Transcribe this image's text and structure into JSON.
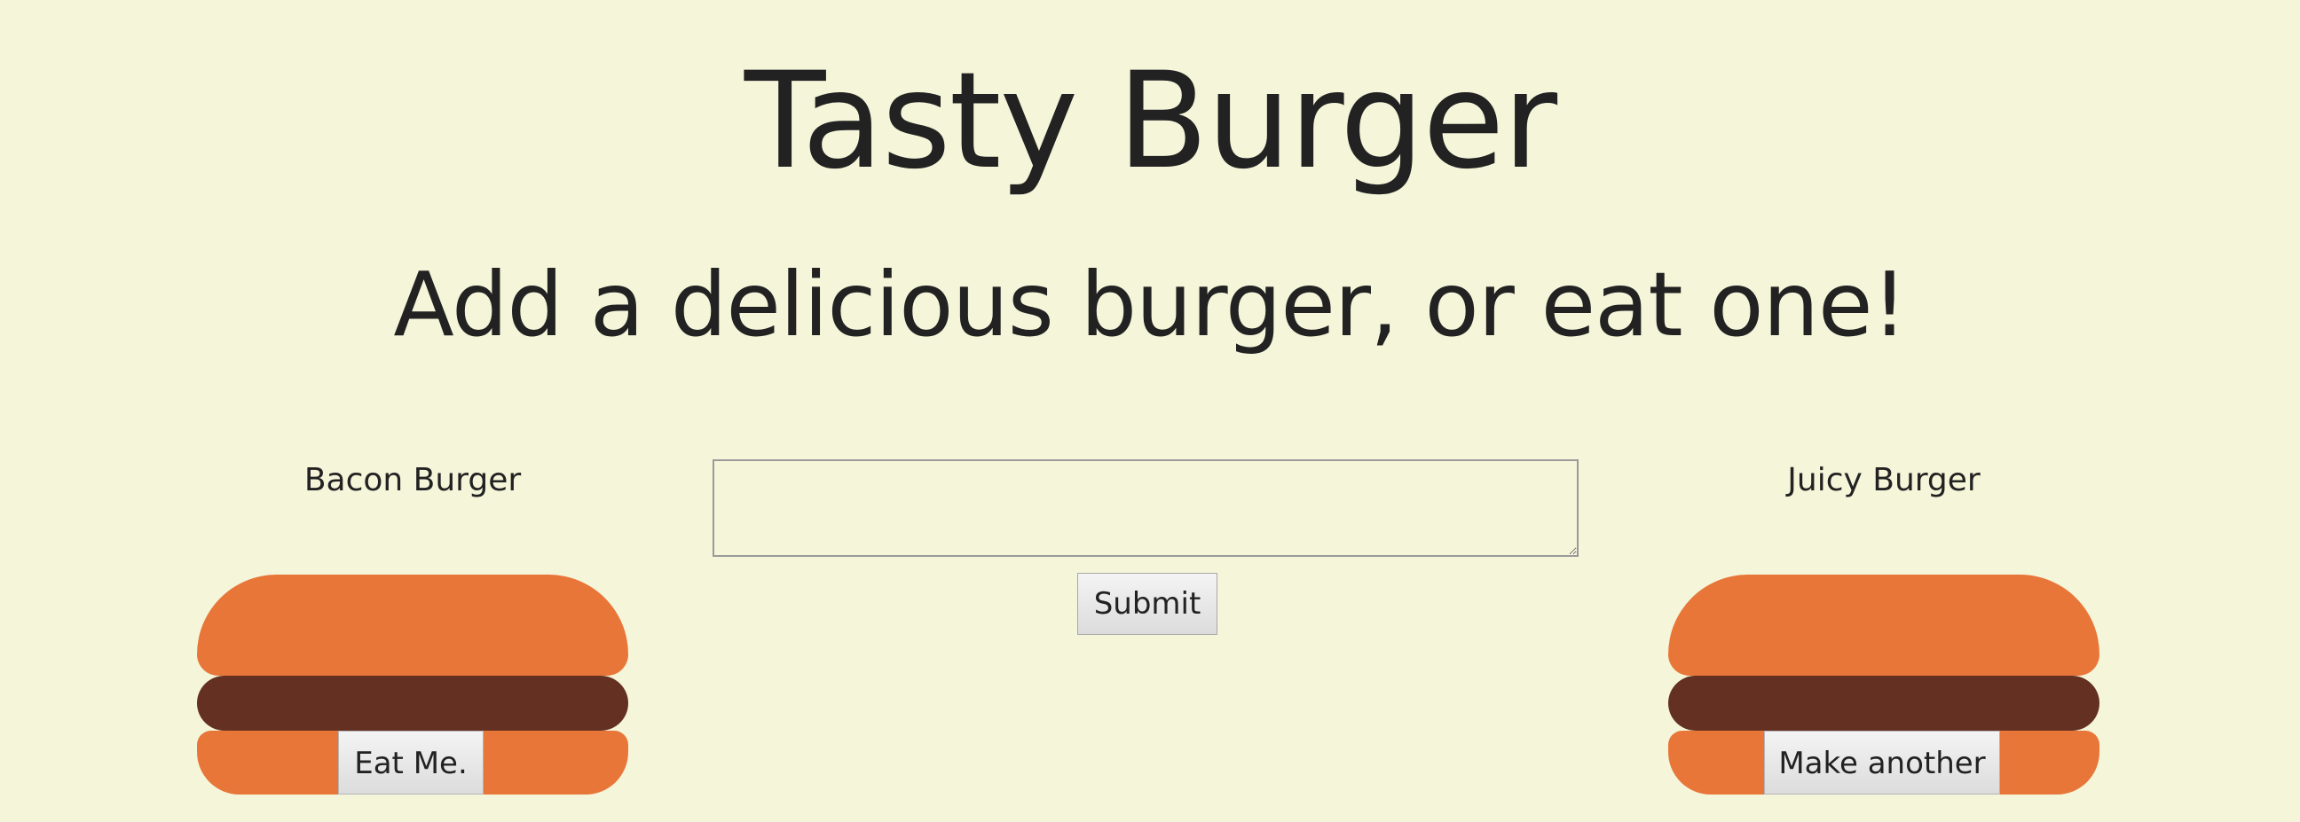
{
  "page": {
    "title": "Tasty Burger",
    "subtitle": "Add a delicious burger, or eat one!"
  },
  "uneaten": {
    "name": "Bacon Burger",
    "button_label": "Eat Me."
  },
  "form": {
    "input_value": "",
    "submit_label": "Submit"
  },
  "eaten": {
    "name": "Juicy Burger",
    "button_label": "Make another"
  },
  "colors": {
    "background": "#f5f5da",
    "bun": "#e87639",
    "patty": "#633021"
  }
}
